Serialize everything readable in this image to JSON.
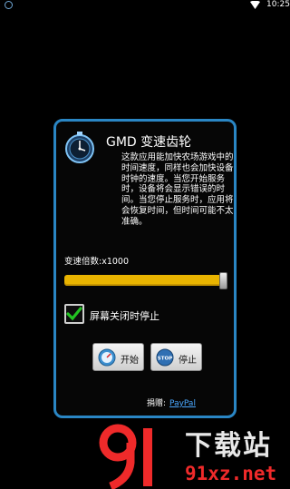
{
  "status_bar": {
    "time": "10:25",
    "icons": [
      "app-notification-icon",
      "wifi-icon"
    ]
  },
  "dialog": {
    "title": "GMD 变速齿轮",
    "description": "这款应用能加快农场游戏中的时间速度，同样也会加快设备时钟的速度。当您开始服务时，设备将会显示错误的时间。当您停止服务时，应用将会恢复时间，但时间可能不太准确。",
    "speed_label": "变速倍数:x1000",
    "slider_value_fraction": 1.0,
    "checkbox": {
      "label": "屏幕关闭时停止",
      "checked": true
    },
    "buttons": {
      "start": "开始",
      "stop": "停止",
      "stop_icon_text": "STOP"
    },
    "donate": {
      "label": "捐赠:",
      "link": "PayPal"
    }
  },
  "watermark": {
    "chinese": "下载站",
    "domain": "91xz.net"
  },
  "colors": {
    "accent_blue": "#2a86c4",
    "slider_yellow": "#e9b400",
    "checkmark_green": "#22c322",
    "link_blue": "#4aa8ff",
    "watermark_red": "#ef2a2a"
  }
}
